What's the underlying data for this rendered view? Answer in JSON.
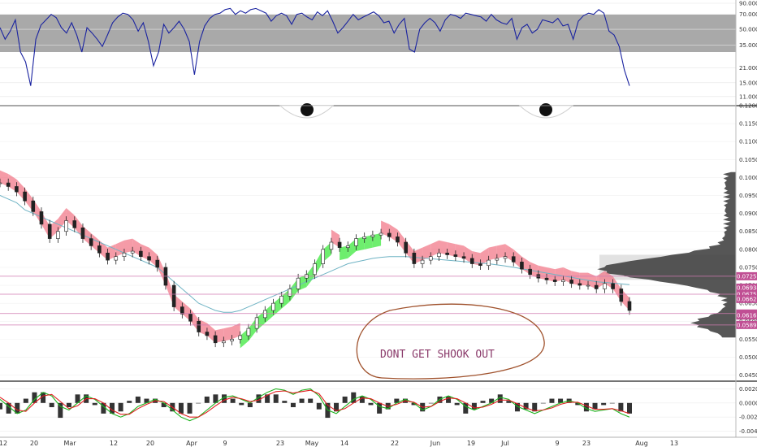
{
  "chart_data": [
    {
      "type": "line",
      "panel": "rsi",
      "ylim": [
        10,
        90
      ],
      "yticks": [
        "90.0000",
        "70.0000",
        "50.0000",
        "35.0000",
        "21.0000",
        "15.0000",
        "11.0000"
      ],
      "ytick_values": [
        90,
        70,
        50,
        35,
        21,
        15,
        11
      ],
      "band": [
        30,
        70
      ],
      "series": [
        {
          "color": "#1a23a0",
          "values": [
            52,
            40,
            48,
            62,
            30,
            24,
            14,
            40,
            55,
            62,
            70,
            65,
            52,
            46,
            58,
            44,
            30,
            52,
            46,
            40,
            34,
            44,
            58,
            66,
            72,
            70,
            62,
            48,
            58,
            38,
            22,
            30,
            56,
            46,
            52,
            60,
            50,
            38,
            18,
            38,
            54,
            64,
            70,
            72,
            78,
            80,
            70,
            76,
            72,
            78,
            80,
            76,
            72,
            60,
            68,
            72,
            68,
            56,
            70,
            72,
            66,
            62,
            74,
            68,
            76,
            60,
            46,
            52,
            60,
            70,
            62,
            66,
            70,
            74,
            68,
            58,
            60,
            46,
            56,
            64,
            32,
            30,
            50,
            58,
            64,
            58,
            48,
            62,
            70,
            68,
            64,
            72,
            70,
            68,
            66,
            60,
            70,
            62,
            58,
            56,
            64,
            40,
            52,
            56,
            46,
            50,
            62,
            60,
            58,
            64,
            54,
            56,
            40,
            60,
            68,
            72,
            70,
            78,
            72,
            48,
            44,
            34,
            20,
            14
          ]
        }
      ]
    },
    {
      "type": "line",
      "panel": "price",
      "x": [
        "12",
        "20",
        "Mar",
        "12",
        "20",
        "Apr",
        "9",
        "23",
        "May",
        "14",
        "22",
        "Jun",
        "19",
        "Jul",
        "9",
        "23",
        "Aug",
        "13"
      ],
      "ylim": [
        0.044,
        0.12
      ],
      "yticks": [
        "0.120000",
        "0.115000",
        "0.110000",
        "0.105000",
        "0.100000",
        "0.095000",
        "0.090000",
        "0.085000",
        "0.080000",
        "0.075000",
        "0.070000",
        "0.065000",
        "0.060000",
        "0.055000",
        "0.050000",
        "0.045000"
      ],
      "ytick_values": [
        0.12,
        0.115,
        0.11,
        0.105,
        0.1,
        0.095,
        0.09,
        0.085,
        0.08,
        0.075,
        0.07,
        0.065,
        0.06,
        0.055,
        0.05,
        0.045
      ],
      "x_tick_labels": [
        "12",
        "20",
        "Mar",
        "12",
        "20",
        "Apr",
        "9",
        "23",
        "May",
        "14",
        "22",
        "Jun",
        "19",
        "Jul",
        "9",
        "23",
        "Aug",
        "13"
      ],
      "series": [
        {
          "color": "#222222",
          "values": [
            0.0985,
            0.0975,
            0.096,
            0.0935,
            0.0905,
            0.087,
            0.083,
            0.085,
            0.088,
            0.086,
            0.083,
            0.081,
            0.079,
            0.077,
            0.078,
            0.079,
            0.0795,
            0.078,
            0.077,
            0.075,
            0.07,
            0.064,
            0.062,
            0.06,
            0.057,
            0.056,
            0.054,
            0.0545,
            0.055,
            0.056,
            0.058,
            0.061,
            0.063,
            0.065,
            0.067,
            0.069,
            0.072,
            0.073,
            0.076,
            0.08,
            0.082,
            0.0805,
            0.081,
            0.083,
            0.0835,
            0.084,
            0.0845,
            0.0835,
            0.082,
            0.079,
            0.076,
            0.077,
            0.078,
            0.079,
            0.0785,
            0.078,
            0.0775,
            0.076,
            0.0755,
            0.077,
            0.0775,
            0.078,
            0.0765,
            0.0745,
            0.073,
            0.072,
            0.0715,
            0.071,
            0.0715,
            0.0705,
            0.07,
            0.07,
            0.069,
            0.0705,
            0.069,
            0.0655,
            0.063
          ]
        },
        {
          "color": "#6fb3c4",
          "values": [
            0.095,
            0.094,
            0.093,
            0.091,
            0.09,
            0.089,
            0.088,
            0.087,
            0.086,
            0.085,
            0.084,
            0.083,
            0.082,
            0.081,
            0.08,
            0.079,
            0.078,
            0.077,
            0.076,
            0.075,
            0.073,
            0.071,
            0.069,
            0.067,
            0.065,
            0.064,
            0.063,
            0.0625,
            0.0625,
            0.063,
            0.064,
            0.065,
            0.066,
            0.067,
            0.068,
            0.069,
            0.07,
            0.071,
            0.072,
            0.073,
            0.074,
            0.075,
            0.076,
            0.0765,
            0.077,
            0.0775,
            0.0778,
            0.078,
            0.078,
            0.078,
            0.0778,
            0.0776,
            0.0774,
            0.0772,
            0.077,
            0.0768,
            0.0766,
            0.0764,
            0.0762,
            0.076,
            0.0757,
            0.0754,
            0.075,
            0.0746,
            0.0742,
            0.0738,
            0.0734,
            0.073,
            0.0726,
            0.0722,
            0.0718,
            0.0714,
            0.071,
            0.0708,
            0.0706,
            0.0704,
            0.0702
          ]
        }
      ],
      "price_badges": [
        "0.072525",
        "0.069342",
        "0.067530",
        "0.066200",
        "0.062150",
        "0.061600",
        "0.058965"
      ],
      "price_badge_values": [
        0.072525,
        0.069342,
        0.06753,
        0.0662,
        0.06215,
        0.0616,
        0.058965
      ],
      "horizontal_lines": [
        0.072525,
        0.06753,
        0.06215,
        0.058965
      ],
      "annotation": "DONT GET SHOOK OUT"
    },
    {
      "type": "line",
      "panel": "macd",
      "ylim": [
        -0.0045,
        0.0025
      ],
      "yticks": [
        "0.0020",
        "0.0000",
        "-0.0020",
        "-0.0040"
      ],
      "ytick_values": [
        0.002,
        0.0,
        -0.002,
        -0.004
      ],
      "series": [
        {
          "color": "#1db31d",
          "values": [
            0.0005,
            -0.0005,
            -0.0015,
            -0.001,
            0.0005,
            0.0015,
            0.001,
            -0.0005,
            -0.001,
            0.0,
            0.001,
            0.0005,
            -0.0005,
            -0.0015,
            -0.002,
            -0.0015,
            -0.0005,
            0.0,
            0.0005,
            0.0,
            -0.001,
            -0.002,
            -0.0025,
            -0.002,
            -0.001,
            0.0,
            0.0008,
            0.001,
            0.0005,
            0.0,
            0.0008,
            0.0015,
            0.002,
            0.0018,
            0.0012,
            0.0018,
            0.002,
            0.001,
            -0.001,
            -0.0015,
            -0.0005,
            0.0005,
            0.001,
            0.0005,
            -0.0005,
            -0.0008,
            0.0,
            0.0005,
            0.0,
            -0.001,
            -0.0005,
            0.0005,
            0.001,
            0.0005,
            -0.0005,
            -0.001,
            -0.0005,
            0.0,
            0.0008,
            0.0005,
            -0.0005,
            -0.001,
            -0.0015,
            -0.001,
            -0.0005,
            0.0,
            0.0003,
            0.0,
            -0.0008,
            -0.0012,
            -0.001,
            -0.0008,
            -0.0015,
            -0.002
          ]
        },
        {
          "color": "#e02020",
          "values": [
            0.0008,
            0.0,
            -0.001,
            -0.0012,
            0.0,
            0.001,
            0.0012,
            0.0002,
            -0.0008,
            -0.0004,
            0.0006,
            0.0006,
            0.0,
            -0.001,
            -0.0016,
            -0.0016,
            -0.0008,
            -0.0002,
            0.0003,
            0.0002,
            -0.0006,
            -0.0015,
            -0.002,
            -0.002,
            -0.0013,
            -0.0004,
            0.0004,
            0.0008,
            0.0006,
            0.0002,
            0.0004,
            0.0011,
            0.0016,
            0.0017,
            0.0014,
            0.0016,
            0.0018,
            0.0013,
            -0.0003,
            -0.0011,
            -0.0008,
            0.0,
            0.0007,
            0.0006,
            0.0,
            -0.0005,
            -0.0002,
            0.0003,
            0.0001,
            -0.0006,
            -0.0005,
            0.0002,
            0.0007,
            0.0006,
            0.0,
            -0.0007,
            -0.0006,
            -0.0002,
            0.0004,
            0.0004,
            -0.0001,
            -0.0007,
            -0.0011,
            -0.001,
            -0.0007,
            -0.0002,
            0.0001,
            0.0001,
            -0.0004,
            -0.0009,
            -0.0009,
            -0.0008,
            -0.0011,
            -0.0015
          ]
        }
      ]
    }
  ]
}
